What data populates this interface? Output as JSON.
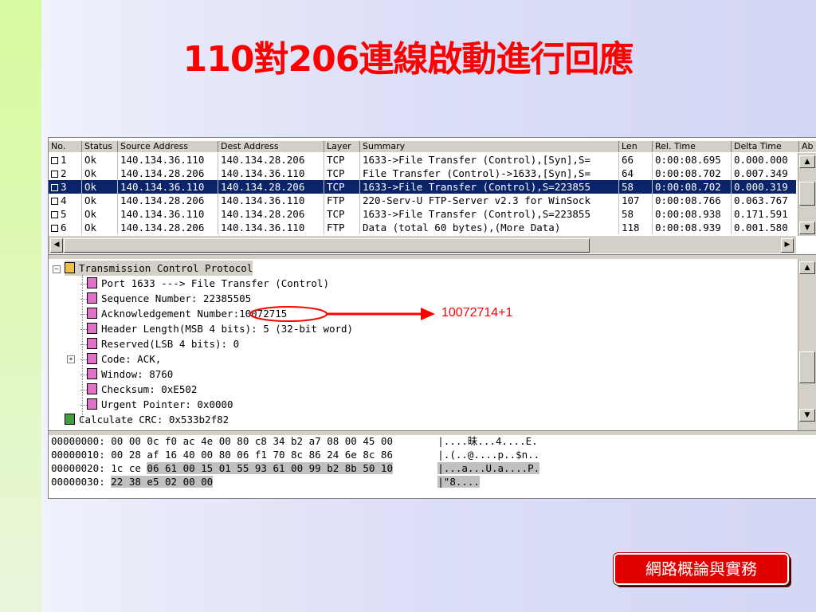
{
  "slide": {
    "title": "110對206連線啟動進行回應",
    "course_badge": "網路概論與實務"
  },
  "packet_list": {
    "columns": [
      "No.",
      "Status",
      "Source Address",
      "Dest Address",
      "Layer",
      "Summary",
      "Len",
      "Rel. Time",
      "Delta Time",
      "Ab"
    ],
    "rows": [
      {
        "no": "1",
        "status": "Ok",
        "src": "140.134.36.110",
        "dst": "140.134.28.206",
        "layer": "TCP",
        "summary": "1633->File Transfer (Control),[Syn],S=",
        "len": "66",
        "rel": "0:00:08.695",
        "delta": "0.000.000",
        "selected": false
      },
      {
        "no": "2",
        "status": "Ok",
        "src": "140.134.28.206",
        "dst": "140.134.36.110",
        "layer": "TCP",
        "summary": "File Transfer (Control)->1633,[Syn],S=",
        "len": "64",
        "rel": "0:00:08.702",
        "delta": "0.007.349",
        "selected": false
      },
      {
        "no": "3",
        "status": "Ok",
        "src": "140.134.36.110",
        "dst": "140.134.28.206",
        "layer": "TCP",
        "summary": "1633->File Transfer (Control),S=223855",
        "len": "58",
        "rel": "0:00:08.702",
        "delta": "0.000.319",
        "selected": true
      },
      {
        "no": "4",
        "status": "Ok",
        "src": "140.134.28.206",
        "dst": "140.134.36.110",
        "layer": "FTP",
        "summary": "220-Serv-U FTP-Server v2.3 for WinSock",
        "len": "107",
        "rel": "0:00:08.766",
        "delta": "0.063.767",
        "selected": false
      },
      {
        "no": "5",
        "status": "Ok",
        "src": "140.134.36.110",
        "dst": "140.134.28.206",
        "layer": "TCP",
        "summary": "1633->File Transfer (Control),S=223855",
        "len": "58",
        "rel": "0:00:08.938",
        "delta": "0.171.591",
        "selected": false
      },
      {
        "no": "6",
        "status": "Ok",
        "src": "140.134.28.206",
        "dst": "140.134.36.110",
        "layer": "FTP",
        "summary": "Data (total 60 bytes),(More Data)",
        "len": "118",
        "rel": "0:00:08.939",
        "delta": "0.001.580",
        "selected": false
      }
    ]
  },
  "decode_tree": {
    "root": "Transmission Control Protocol",
    "fields": [
      "Port 1633 ---> File Transfer (Control)",
      "Sequence Number: 22385505",
      "Acknowledgement Number:",
      "Header Length(MSB 4 bits): 5 (32-bit word)",
      "Reserved(LSB 4 bits): 0",
      "Code: ACK,",
      "Window: 8760",
      "Checksum: 0xE502",
      "Urgent Pointer: 0x0000"
    ],
    "ack_value": "10072715",
    "crc": "Calculate CRC: 0x533b2f82"
  },
  "annotation": "10072714+1",
  "hex_dump": [
    {
      "offset": "00000000:",
      "pre": "00 00 0c f0 ac 4e 00 80 c8 34 b2 a7 08 00 45 00",
      "hl": "",
      "ascii": "|....昧...4....E."
    },
    {
      "offset": "00000010:",
      "pre": "00 28 af 16 40 00 80 06 f1 70 8c 86 24 6e 8c 86",
      "hl": "",
      "ascii": "|.(..@....p..$n.."
    },
    {
      "offset": "00000020:",
      "pre": "1c ce ",
      "hl": "06 61 00 15 01 55 93 61 00 99 b2 8b 50 10",
      "ascii": "|...a...U.a....P."
    },
    {
      "offset": "00000030:",
      "pre": "",
      "hl": "22 38 e5 02 00 00",
      "ascii": "|\"8...."
    }
  ]
}
